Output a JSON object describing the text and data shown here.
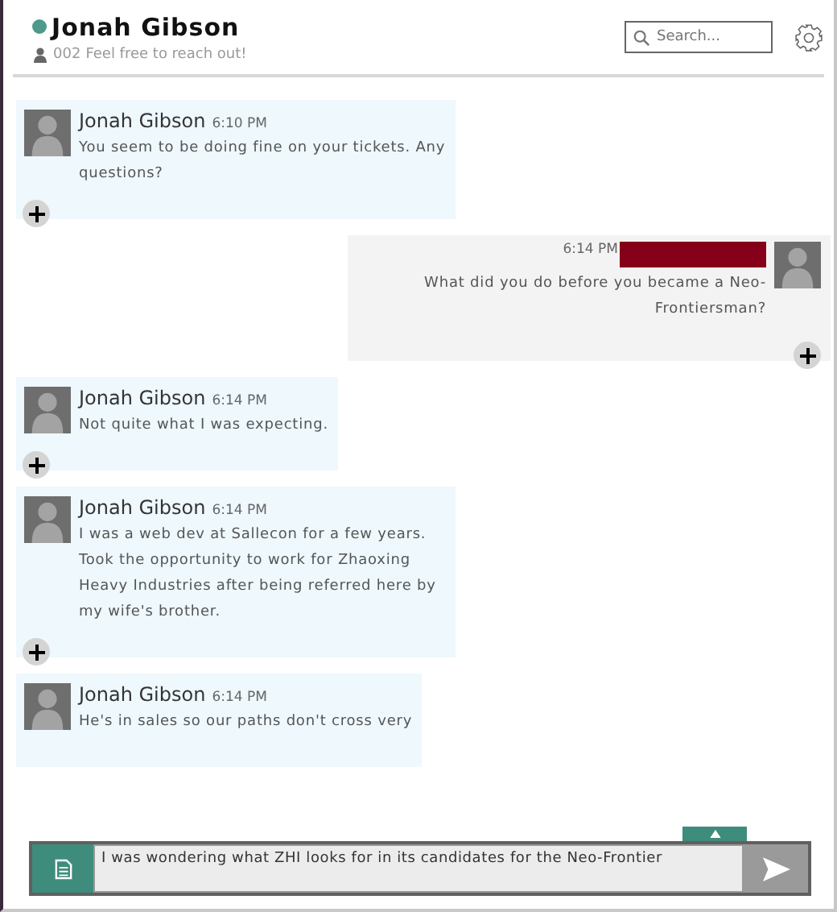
{
  "header": {
    "title": "Jonah Gibson",
    "online": true,
    "status_id": "002",
    "status_text": "Feel free to reach out!"
  },
  "search": {
    "placeholder": "Search..."
  },
  "messages": [
    {
      "kind": "incoming",
      "sender": "Jonah Gibson",
      "time": "6:10 PM",
      "text": "You seem to be doing fine on your tickets. Any questions?"
    },
    {
      "kind": "outgoing",
      "time": "6:14 PM",
      "text": "What did you do before you became a Neo-Frontiersman?"
    },
    {
      "kind": "incoming",
      "sender": "Jonah Gibson",
      "time": "6:14 PM",
      "text": "Not quite what I was expecting."
    },
    {
      "kind": "incoming",
      "sender": "Jonah Gibson",
      "time": "6:14 PM",
      "text": "I was a web dev at Sallecon for a few years. Took the opportunity to work for Zhaoxing Heavy Industries after being referred here by my wife's brother."
    },
    {
      "kind": "incoming",
      "sender": "Jonah Gibson",
      "time": "6:14 PM",
      "text": "He's in sales so our paths don't cross very"
    }
  ],
  "composer": {
    "value": "I was wondering what ZHI looks for in its candidates for the Neo-Frontier"
  }
}
